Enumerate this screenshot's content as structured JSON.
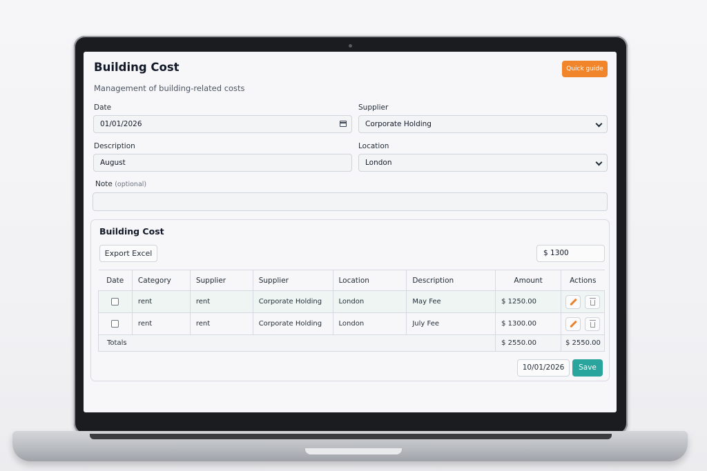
{
  "header": {
    "title": "Building Cost",
    "subtitle": "Management of building-related costs",
    "quick_guide_label": "Quick guide"
  },
  "form": {
    "date_label": "Date",
    "date_value": "01/01/2026",
    "supplier_label": "Supplier",
    "supplier_value": "Corporate Holding",
    "description_label": "Description",
    "description_value": "August",
    "location_label": "Location",
    "location_value": "London",
    "note_label": "Note",
    "note_optional": "(optional)",
    "note_value": ""
  },
  "panel": {
    "title": "Building Cost",
    "export_label": "Export Excel",
    "amount_value": "$ 1300",
    "columns": [
      "Date",
      "Category",
      "Supplier",
      "Supplier",
      "Location",
      "Description",
      "Amount",
      "Actions"
    ],
    "rows": [
      {
        "category": "rent",
        "supplier1": "rent",
        "supplier2": "Corporate Holding",
        "location": "London",
        "description": "May Fee",
        "amount": "$ 1250.00"
      },
      {
        "category": "rent",
        "supplier1": "rent",
        "supplier2": "Corporate Holding",
        "location": "London",
        "description": "July Fee",
        "amount": "$ 1300.00"
      }
    ],
    "totals_label": "Totals",
    "totals_amount": "$ 2550.00",
    "totals_actions": "$ 2550.00",
    "footer_date": "10/01/2026",
    "save_label": "Save"
  },
  "colors": {
    "accent_orange": "#f0852b",
    "accent_teal": "#2aa59d"
  }
}
